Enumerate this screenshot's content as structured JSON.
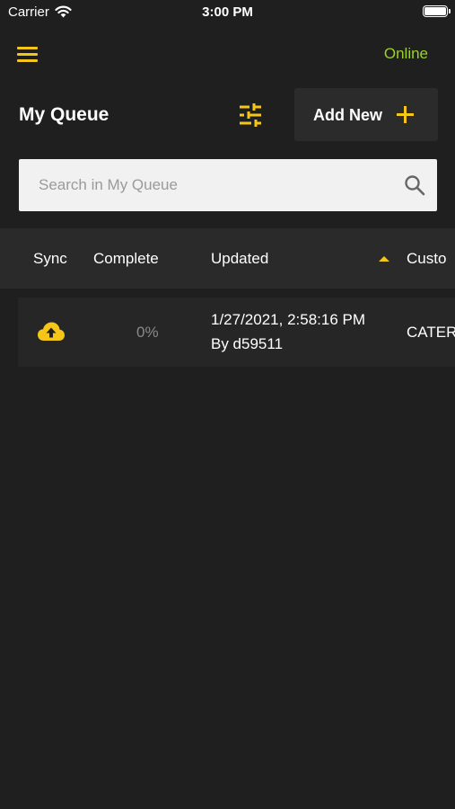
{
  "status_bar": {
    "carrier": "Carrier",
    "time": "3:00 PM"
  },
  "header": {
    "menu_icon": "hamburger-menu-icon",
    "connection_status": "Online",
    "connection_color": "#9bd12a"
  },
  "toolbar": {
    "title": "My Queue",
    "filter_icon": "sliders-filter-icon",
    "add_new_label": "Add New",
    "add_icon": "plus-icon"
  },
  "search": {
    "placeholder": "Search in My Queue",
    "value": "",
    "icon": "search-icon"
  },
  "table": {
    "columns": [
      "Sync",
      "Complete",
      "Updated",
      "Custo"
    ],
    "sorted_column": "Updated",
    "sort_direction": "ascending",
    "rows": [
      {
        "sync_icon": "cloud-upload-icon",
        "complete": "0%",
        "updated_date": "1/27/2021, 2:58:16 PM",
        "updated_by": "By d59511",
        "customer": "CATER"
      }
    ]
  },
  "colors": {
    "accent": "#f5c518",
    "background": "#1f1f1f",
    "header_row": "#2a2a2a",
    "row": "#262626"
  }
}
